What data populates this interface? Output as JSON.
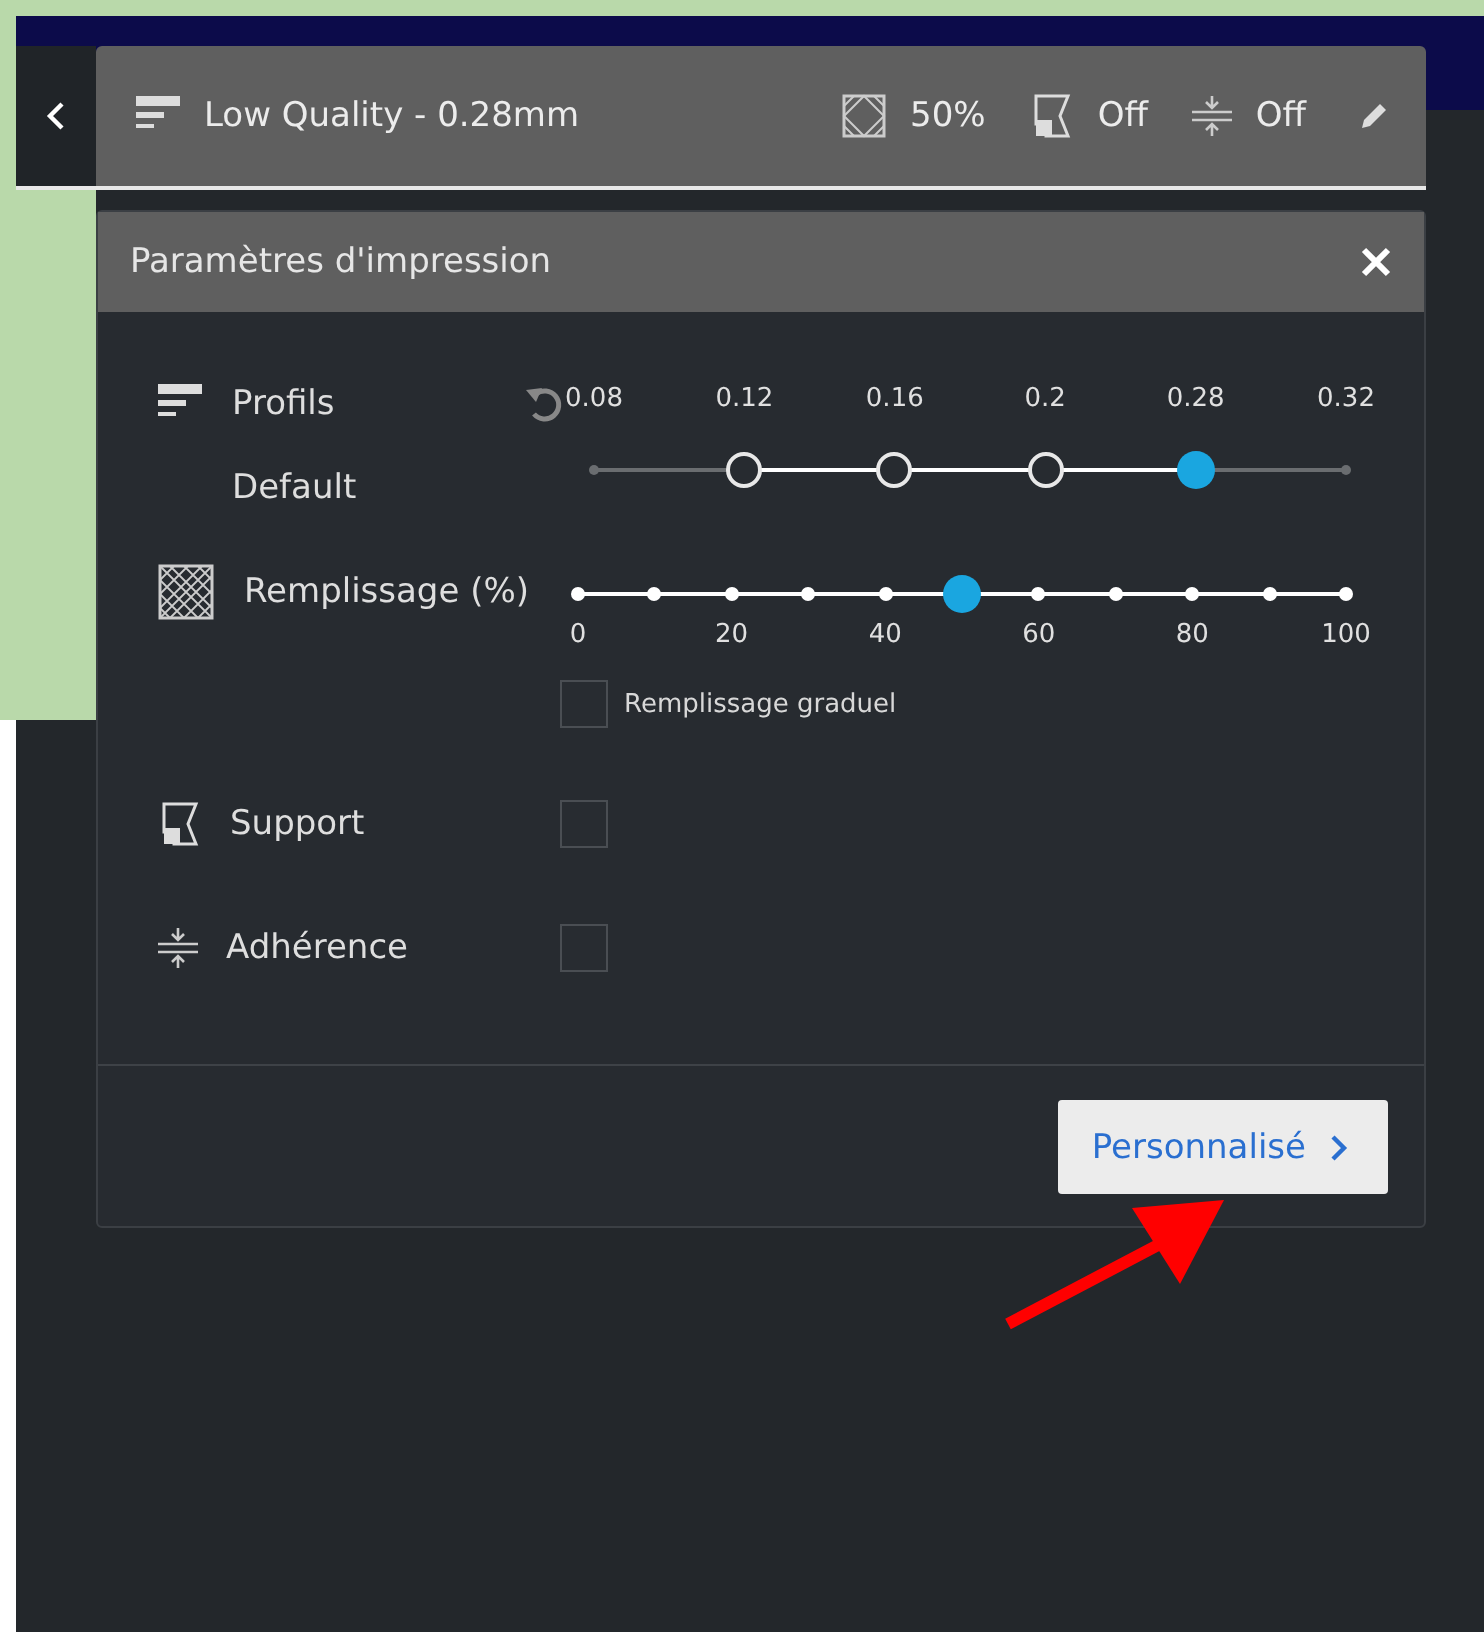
{
  "header": {
    "profile": "Low Quality - 0.28mm",
    "infill": "50%",
    "support": "Off",
    "adhesion": "Off"
  },
  "panel": {
    "title": "Paramètres d'impression",
    "profile": {
      "label": "Profils",
      "sublabel": "Default",
      "level": 0.8,
      "ticks": [
        {
          "label": "0.08",
          "available": false
        },
        {
          "label": "0.12",
          "available": true
        },
        {
          "label": "0.16",
          "available": true
        },
        {
          "label": "0.2",
          "available": true
        },
        {
          "label": "0.28",
          "available": true
        },
        {
          "label": "0.32",
          "available": false
        }
      ]
    },
    "infill": {
      "label": "Remplissage (%)",
      "level": 0.5,
      "ticks": [
        "0",
        "20",
        "40",
        "60",
        "80",
        "100"
      ],
      "gradual": {
        "label": "Remplissage graduel",
        "checked": false
      }
    },
    "options": [
      {
        "kind": "support",
        "label": "Support",
        "checked": false
      },
      {
        "kind": "adhesion",
        "label": "Adhérence",
        "checked": false
      }
    ],
    "button": "Personnalisé"
  }
}
